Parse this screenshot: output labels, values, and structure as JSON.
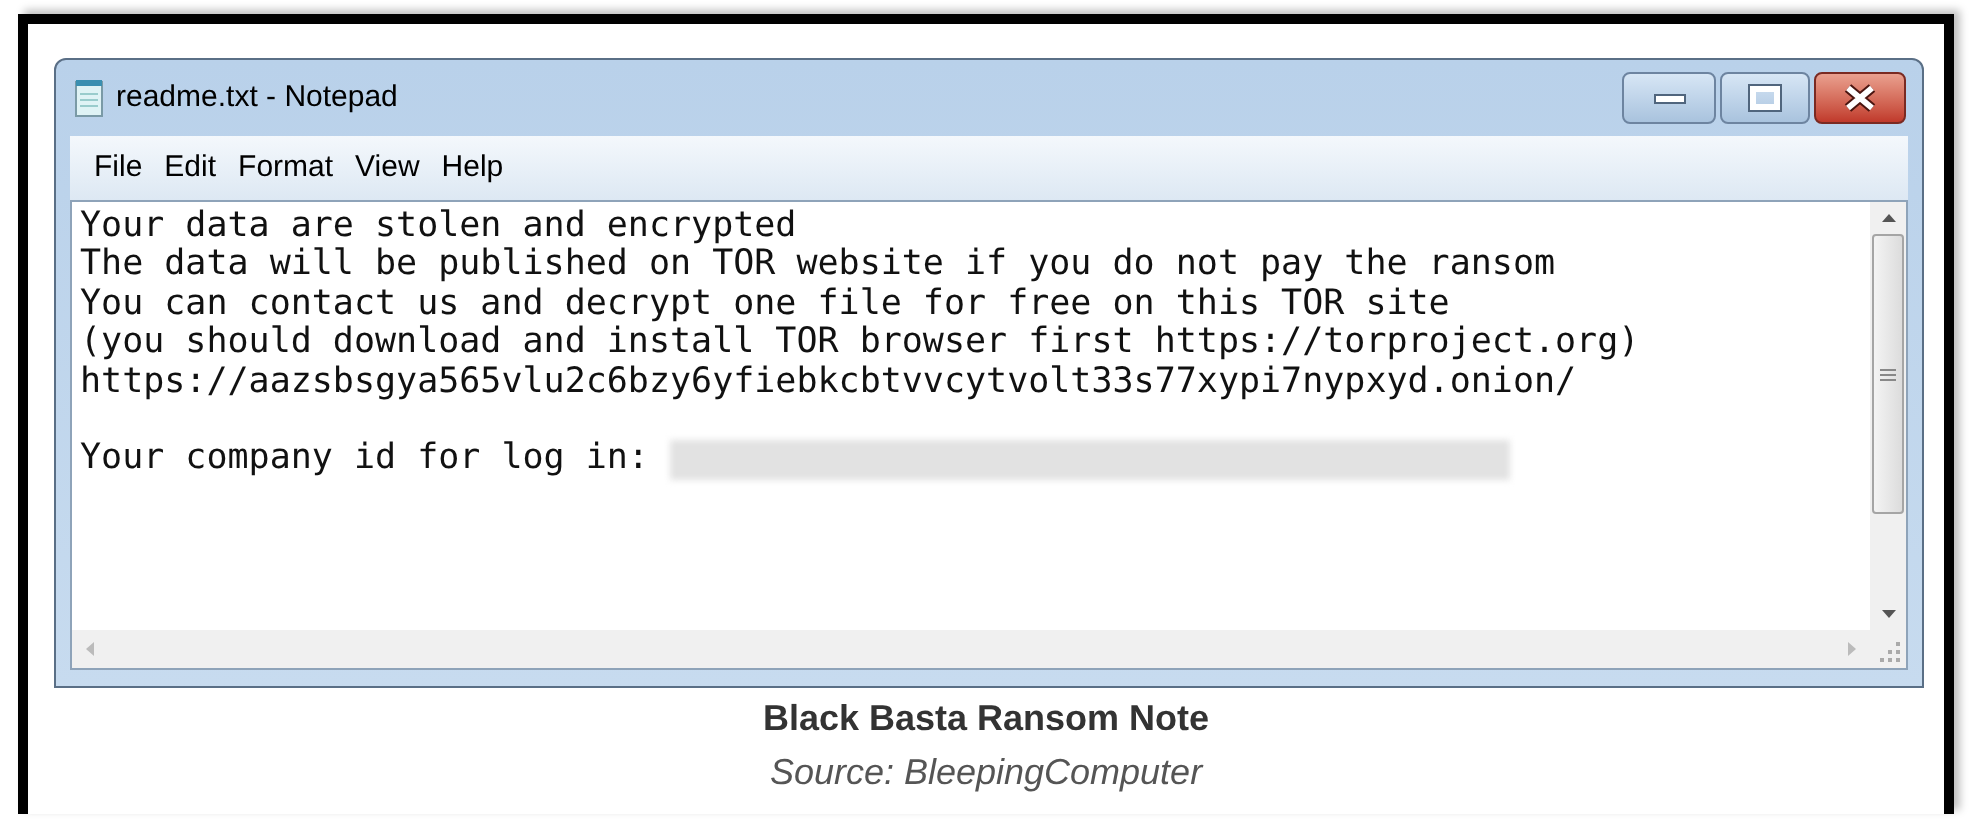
{
  "window": {
    "title": "readme.txt - Notepad"
  },
  "menu": [
    {
      "label": "File"
    },
    {
      "label": "Edit"
    },
    {
      "label": "Format"
    },
    {
      "label": "View"
    },
    {
      "label": "Help"
    }
  ],
  "document": {
    "lines": [
      {
        "text": "Your data are stolen and encrypted"
      },
      {
        "text": "The data will be published on TOR website if you do not pay the ransom"
      },
      {
        "text": "You can contact us and decrypt one file for free on this TOR site"
      },
      {
        "text": "(you should download and install TOR browser first https://torproject.org)"
      },
      {
        "text": "https://aazsbsgya565vlu2c6bzy6yfiebkcbtvvcytvolt33s77xypi7nypxyd.onion/"
      },
      {
        "text": "Your company id for log in:",
        "blank_line_before": true,
        "redacted": true
      }
    ]
  },
  "caption": {
    "title": "Black Basta Ransom Note",
    "source": "Source: BleepingComputer"
  }
}
